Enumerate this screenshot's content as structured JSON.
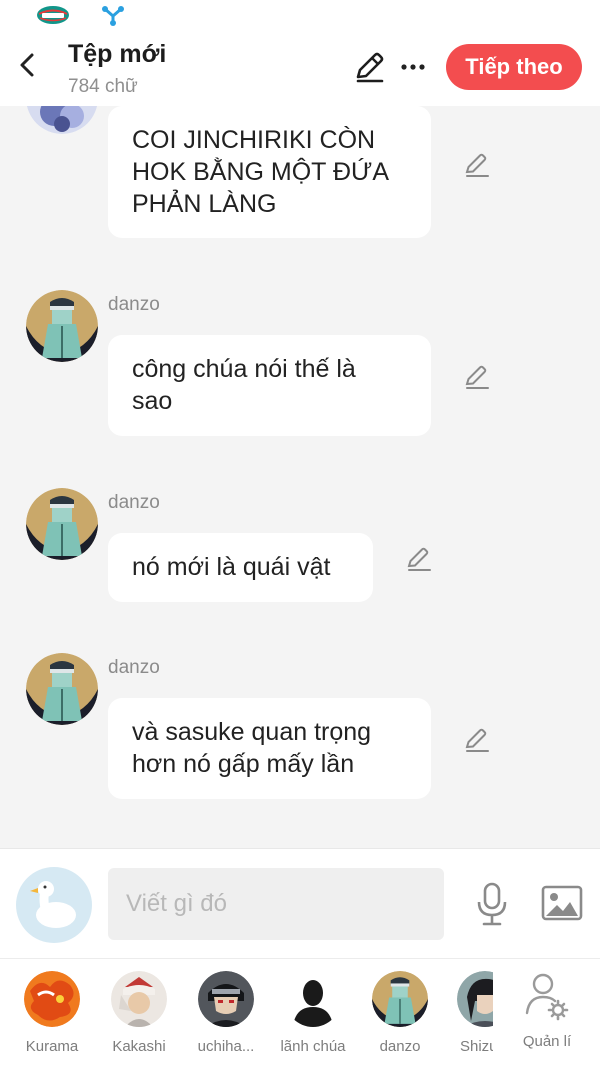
{
  "header": {
    "title": "Tệp mới",
    "subtitle": "784 chữ",
    "next_label": "Tiếp theo"
  },
  "messages": [
    {
      "sender": "",
      "text_lines": [
        "COI JINCHIRIKI CÒN",
        "HOK BẰNG MỘT ĐỨA",
        "PHẢN LÀNG"
      ]
    },
    {
      "sender": "danzo",
      "text_lines": [
        "công chúa nói thế là",
        "sao"
      ]
    },
    {
      "sender": "danzo",
      "text_lines": [
        "nó mới là quái vật"
      ]
    },
    {
      "sender": "danzo",
      "text_lines": [
        "và sasuke quan trọng",
        "hơn nó gấp mấy lần"
      ]
    }
  ],
  "composer": {
    "placeholder": "Viết gì đó"
  },
  "characters": [
    {
      "name": "Kurama"
    },
    {
      "name": "Kakashi"
    },
    {
      "name": "uchiha..."
    },
    {
      "name": "lãnh chúa"
    },
    {
      "name": "danzo"
    },
    {
      "name": "Shizu"
    }
  ],
  "manage_label": "Quản lí",
  "icons": {
    "status_logo": "carrier-logo-icon",
    "status_app": "share-nodes-icon",
    "back": "back-chevron-icon",
    "edit": "pencil-icon",
    "more": "more-dots-icon",
    "message_edit": "pencil-icon",
    "mic": "microphone-icon",
    "image": "image-icon",
    "manage": "user-settings-icon"
  },
  "colors": {
    "accent": "#f34d4f",
    "background": "#f4f4f4",
    "bubble": "#ffffff",
    "muted_text": "#8b8b8b"
  }
}
